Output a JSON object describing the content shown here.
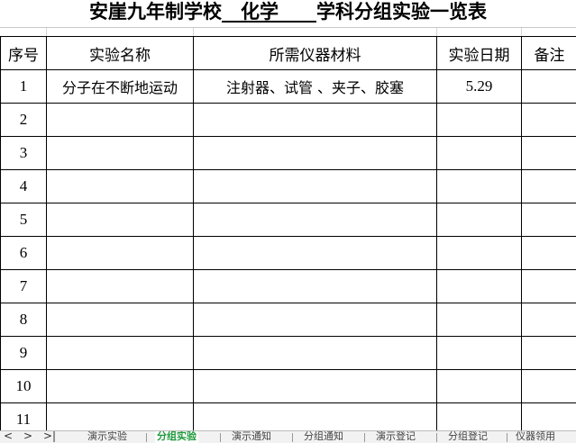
{
  "title": {
    "part1": "安崖九年制学校",
    "blank1": "__",
    "subject": "化学",
    "blank2": "____",
    "part2": "学科分组实验一览表"
  },
  "headers": [
    "序号",
    "实验名称",
    "所需仪器材料",
    "实验日期",
    "备注"
  ],
  "rows": [
    {
      "no": "1",
      "name": "分子在不断地运动",
      "materials": "注射器、试管 、夹子、胶塞",
      "date": "5.29",
      "note": ""
    },
    {
      "no": "2",
      "name": "",
      "materials": "",
      "date": "",
      "note": ""
    },
    {
      "no": "3",
      "name": "",
      "materials": "",
      "date": "",
      "note": ""
    },
    {
      "no": "4",
      "name": "",
      "materials": "",
      "date": "",
      "note": ""
    },
    {
      "no": "5",
      "name": "",
      "materials": "",
      "date": "",
      "note": ""
    },
    {
      "no": "6",
      "name": "",
      "materials": "",
      "date": "",
      "note": ""
    },
    {
      "no": "7",
      "name": "",
      "materials": "",
      "date": "",
      "note": ""
    },
    {
      "no": "8",
      "name": "",
      "materials": "",
      "date": "",
      "note": ""
    },
    {
      "no": "9",
      "name": "",
      "materials": "",
      "date": "",
      "note": ""
    },
    {
      "no": "10",
      "name": "",
      "materials": "",
      "date": "",
      "note": ""
    },
    {
      "no": "11",
      "name": "",
      "materials": "",
      "date": "",
      "note": ""
    }
  ],
  "tabbar": {
    "nav": [
      "<",
      ">",
      ">|"
    ],
    "tabs": [
      "演示实验",
      "分组实验",
      "演示通知",
      "分组通知",
      "演示登记",
      "分组登记",
      "仪器领用"
    ],
    "active_index": 1,
    "active_color": "#1e9a3c"
  }
}
